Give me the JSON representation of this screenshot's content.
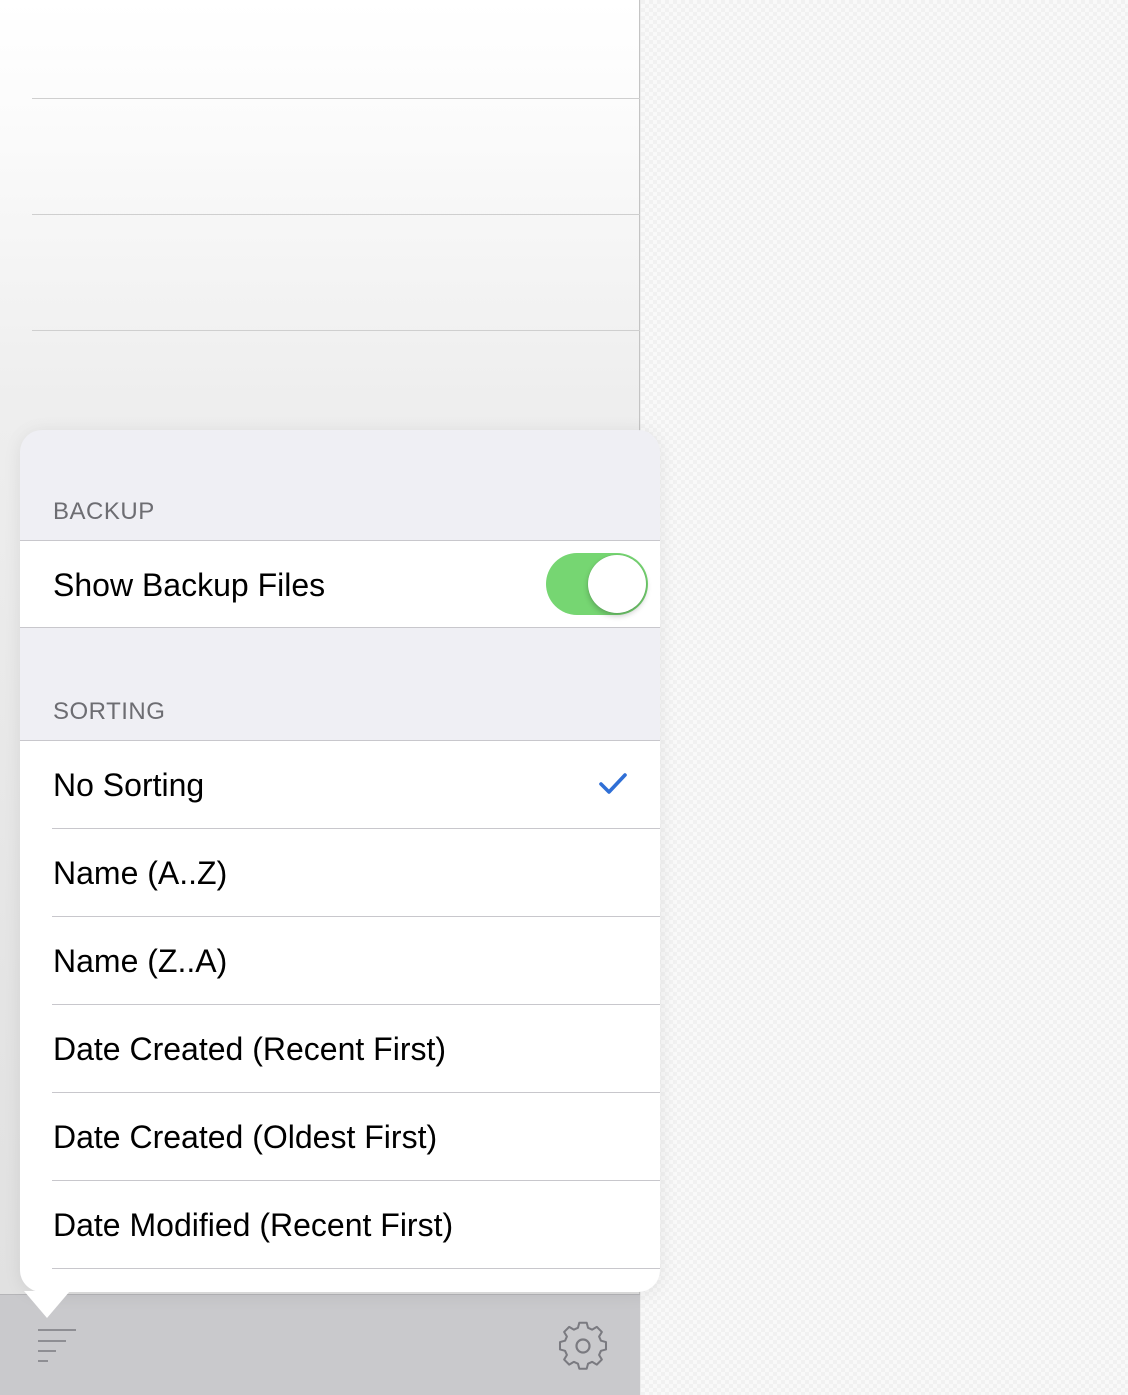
{
  "popover": {
    "backup_header": "BACKUP",
    "show_backup_files": {
      "label": "Show Backup Files",
      "enabled": true
    },
    "sorting_header": "SORTING",
    "sort_options": [
      {
        "label": "No Sorting",
        "selected": true
      },
      {
        "label": "Name (A..Z)",
        "selected": false
      },
      {
        "label": "Name (Z..A)",
        "selected": false
      },
      {
        "label": "Date Created (Recent First)",
        "selected": false
      },
      {
        "label": "Date Created (Oldest First)",
        "selected": false
      },
      {
        "label": "Date Modified (Recent First)",
        "selected": false
      },
      {
        "label": "",
        "selected": false
      }
    ]
  },
  "toolbar": {
    "left_icon": "sort-icon",
    "right_icon": "gear-icon"
  },
  "colors": {
    "toggle_on": "#76d672",
    "checkmark": "#2f6fd6",
    "section_header": "#6d6d72",
    "toolbar_bg": "#c9c9cc"
  }
}
